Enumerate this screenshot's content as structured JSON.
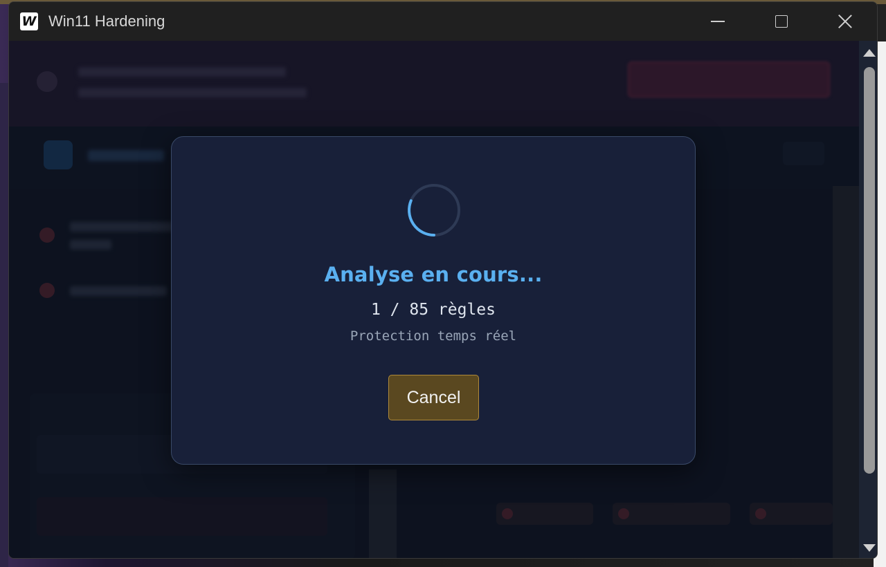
{
  "window": {
    "app_icon_letter": "W",
    "title": "Win11 Hardening"
  },
  "dialog": {
    "title": "Analyse en cours...",
    "progress": "1 / 85 règles",
    "current_rule": "Protection temps réel",
    "cancel_label": "Cancel",
    "progress_fraction": 0.012
  },
  "colors": {
    "accent": "#5ab0f0",
    "modal_bg": "#182039",
    "cancel_bg": "#5a4820",
    "cancel_border": "#b08a3a"
  }
}
